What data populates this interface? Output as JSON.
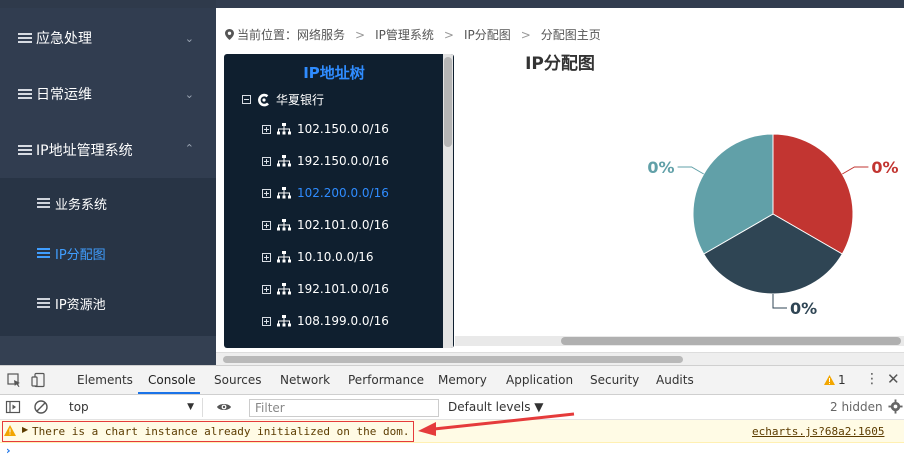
{
  "sidebar": {
    "items": [
      {
        "label": "应急处理",
        "chevron": "chevron-down"
      },
      {
        "label": "日常运维",
        "chevron": "chevron-down"
      },
      {
        "label": "IP地址管理系统",
        "chevron": "chevron-up"
      }
    ],
    "sub_items": [
      {
        "label": "业务系统",
        "active": false
      },
      {
        "label": "IP分配图",
        "active": true
      },
      {
        "label": "IP资源池",
        "active": false
      }
    ],
    "accent_color": "#409eff"
  },
  "breadcrumb": {
    "prefix": "当前位置：",
    "items": [
      "网络服务",
      "IP管理系统",
      "IP分配图",
      "分配图主页"
    ],
    "separator": ">"
  },
  "tree": {
    "title": "IP地址树",
    "root": "华夏银行",
    "nodes": [
      {
        "label": "102.150.0.0/16",
        "active": false
      },
      {
        "label": "192.150.0.0/16",
        "active": false
      },
      {
        "label": "102.200.0.0/16",
        "active": true
      },
      {
        "label": "102.101.0.0/16",
        "active": false
      },
      {
        "label": "10.10.0.0/16",
        "active": false
      },
      {
        "label": "192.101.0.0/16",
        "active": false
      },
      {
        "label": "108.199.0.0/16",
        "active": false
      }
    ]
  },
  "chart_data": {
    "type": "pie",
    "title": "IP分配图",
    "slices": [
      {
        "label": "0%",
        "value": 1,
        "color": "#c23531"
      },
      {
        "label": "0%",
        "value": 1,
        "color": "#2f4554"
      },
      {
        "label": "0%",
        "value": 1,
        "color": "#61a0a8"
      }
    ]
  },
  "devtools": {
    "tabs": [
      "Elements",
      "Console",
      "Sources",
      "Network",
      "Performance",
      "Memory",
      "Application",
      "Security",
      "Audits"
    ],
    "active_tab": "Console",
    "warning_count": "1",
    "context": "top",
    "filter_placeholder": "Filter",
    "levels": "Default levels ▼",
    "hidden": "2 hidden",
    "message": "There is a chart instance already initialized on the dom.",
    "source": "echarts.js?68a2:1605",
    "prompt": "›",
    "colors": {
      "warning_bg": "#fffbe5",
      "highlight": "#e53b3b",
      "tab_underline": "#1a73e8"
    }
  }
}
